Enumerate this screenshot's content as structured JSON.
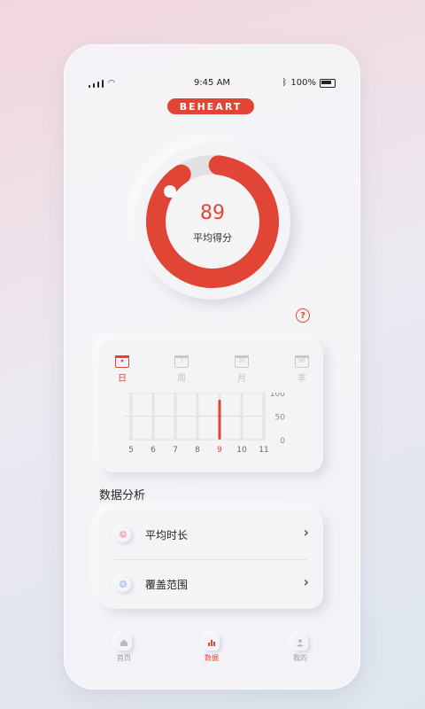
{
  "status": {
    "time": "9:45 AM",
    "battery": "100%"
  },
  "brand": "BEHEART",
  "gauge": {
    "score": "89",
    "label": "平均得分",
    "progress": 0.89,
    "accent": "#e04535"
  },
  "help_label": "?",
  "tabs": [
    {
      "label": "日",
      "icon_text": "",
      "active": true
    },
    {
      "label": "周",
      "icon_text": "7",
      "active": false
    },
    {
      "label": "月",
      "icon_text": "30",
      "active": false
    },
    {
      "label": "季",
      "icon_text": "90",
      "active": false
    }
  ],
  "chart_data": {
    "type": "bar",
    "categories": [
      "5",
      "6",
      "7",
      "8",
      "9",
      "10",
      "11"
    ],
    "values": [
      0,
      0,
      0,
      0,
      100,
      0,
      0
    ],
    "y_ticks": [
      "100",
      "50",
      "0"
    ],
    "ylim": [
      0,
      100
    ],
    "highlight_color": "#e04535"
  },
  "section_title": "数据分析",
  "analysis": [
    {
      "label": "平均时长",
      "icon": "clock-icon"
    },
    {
      "label": "覆盖范围",
      "icon": "coverage-icon"
    }
  ],
  "nav": [
    {
      "label": "首页",
      "icon": "home-icon",
      "active": false
    },
    {
      "label": "数据",
      "icon": "chart-icon",
      "active": true
    },
    {
      "label": "我的",
      "icon": "user-icon",
      "active": false
    }
  ]
}
